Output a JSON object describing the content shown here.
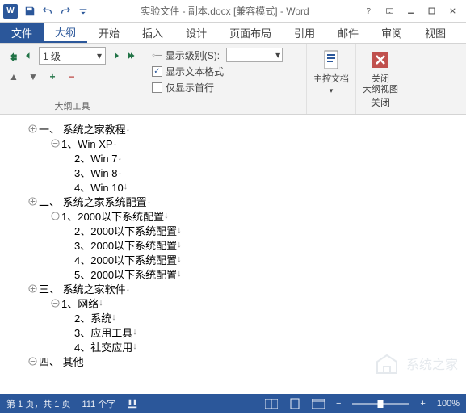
{
  "titlebar": {
    "app_letter": "W",
    "title": "实验文件 - 副本.docx [兼容模式] - Word"
  },
  "tabs": {
    "file": "文件",
    "outline": "大纲",
    "home": "开始",
    "insert": "插入",
    "design": "设计",
    "layout": "页面布局",
    "references": "引用",
    "mail": "邮件",
    "review": "审阅",
    "view": "视图"
  },
  "ribbon": {
    "level_value": "1 级",
    "show_level_label": "显示级别(S):",
    "show_formatting": "显示文本格式",
    "first_line_only": "仅显示首行",
    "tools_group": "大纲工具",
    "master_doc": "主控文档",
    "close_outline": "关闭\n大纲视图",
    "close_group": "关闭"
  },
  "outline": [
    {
      "indent": 0,
      "bullet": "plus",
      "text": "一、 系统之家教程",
      "mark": "↓"
    },
    {
      "indent": 1,
      "bullet": "minus",
      "text": "1、Win XP",
      "mark": "↓"
    },
    {
      "indent": 1,
      "bullet": "",
      "text": "2、Win 7",
      "mark": "↓"
    },
    {
      "indent": 1,
      "bullet": "",
      "text": "3、Win 8",
      "mark": "↓"
    },
    {
      "indent": 1,
      "bullet": "",
      "text": "4、Win 10",
      "mark": "↓"
    },
    {
      "indent": 0,
      "bullet": "plus",
      "text": "二、 系统之家系统配置",
      "mark": "↓"
    },
    {
      "indent": 1,
      "bullet": "minus",
      "text": "1、2000以下系统配置",
      "mark": "↓"
    },
    {
      "indent": 1,
      "bullet": "",
      "text": "2、2000以下系统配置",
      "mark": "↓"
    },
    {
      "indent": 1,
      "bullet": "",
      "text": "3、2000以下系统配置",
      "mark": "↓"
    },
    {
      "indent": 1,
      "bullet": "",
      "text": "4、2000以下系统配置",
      "mark": "↓"
    },
    {
      "indent": 1,
      "bullet": "",
      "text": "5、2000以下系统配置",
      "mark": "↓"
    },
    {
      "indent": 0,
      "bullet": "plus",
      "text": "三、 系统之家软件",
      "mark": "↓"
    },
    {
      "indent": 1,
      "bullet": "minus",
      "text": "1、网络",
      "mark": "↓"
    },
    {
      "indent": 1,
      "bullet": "",
      "text": "2、系统",
      "mark": "↓"
    },
    {
      "indent": 1,
      "bullet": "",
      "text": "3、应用工具",
      "mark": "↓"
    },
    {
      "indent": 1,
      "bullet": "",
      "text": "4、社交应用",
      "mark": "↓"
    },
    {
      "indent": 0,
      "bullet": "minus",
      "text": "四、 其他",
      "mark": ""
    }
  ],
  "watermark": "系统之家",
  "statusbar": {
    "page": "第 1 页，共 1 页",
    "words": "111 个字",
    "zoom": "100%"
  }
}
